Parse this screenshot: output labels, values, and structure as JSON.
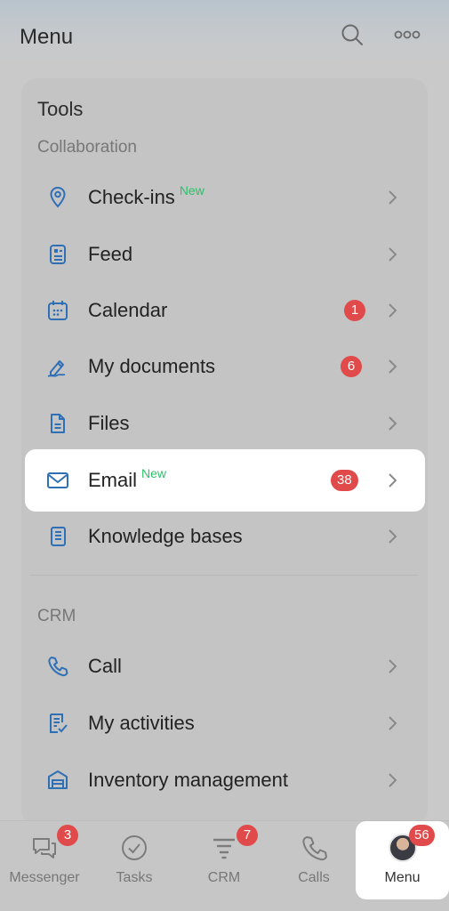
{
  "header": {
    "title": "Menu",
    "icons": [
      "search-icon",
      "more-icon"
    ]
  },
  "tools": {
    "title": "Tools",
    "collaboration_label": "Collaboration",
    "items": [
      {
        "label": "Check-ins",
        "new": "New",
        "icon": "location-pin-icon"
      },
      {
        "label": "Feed",
        "icon": "feed-icon"
      },
      {
        "label": "Calendar",
        "badge": "1",
        "icon": "calendar-icon"
      },
      {
        "label": "My documents",
        "badge": "6",
        "icon": "document-sign-icon"
      },
      {
        "label": "Files",
        "icon": "file-icon"
      },
      {
        "label": "Email",
        "new": "New",
        "badge": "38",
        "icon": "envelope-icon"
      },
      {
        "label": "Knowledge bases",
        "icon": "book-icon"
      }
    ],
    "crm_label": "CRM",
    "crm_items": [
      {
        "label": "Call",
        "icon": "phone-icon"
      },
      {
        "label": "My activities",
        "icon": "activities-icon"
      },
      {
        "label": "Inventory management",
        "icon": "warehouse-icon"
      }
    ]
  },
  "tabbar": {
    "tabs": [
      {
        "label": "Messenger",
        "badge": "3",
        "icon": "chat-icon"
      },
      {
        "label": "Tasks",
        "icon": "check-circle-icon"
      },
      {
        "label": "CRM",
        "badge": "7",
        "icon": "funnel-icon"
      },
      {
        "label": "Calls",
        "icon": "phone-icon"
      },
      {
        "label": "Menu",
        "badge": "56",
        "icon": "avatar",
        "active": true
      }
    ]
  },
  "colors": {
    "accent": "#2f6fb5",
    "badge": "#e04a4a",
    "new": "#2fbf6a",
    "highlight": "#ffffff"
  }
}
